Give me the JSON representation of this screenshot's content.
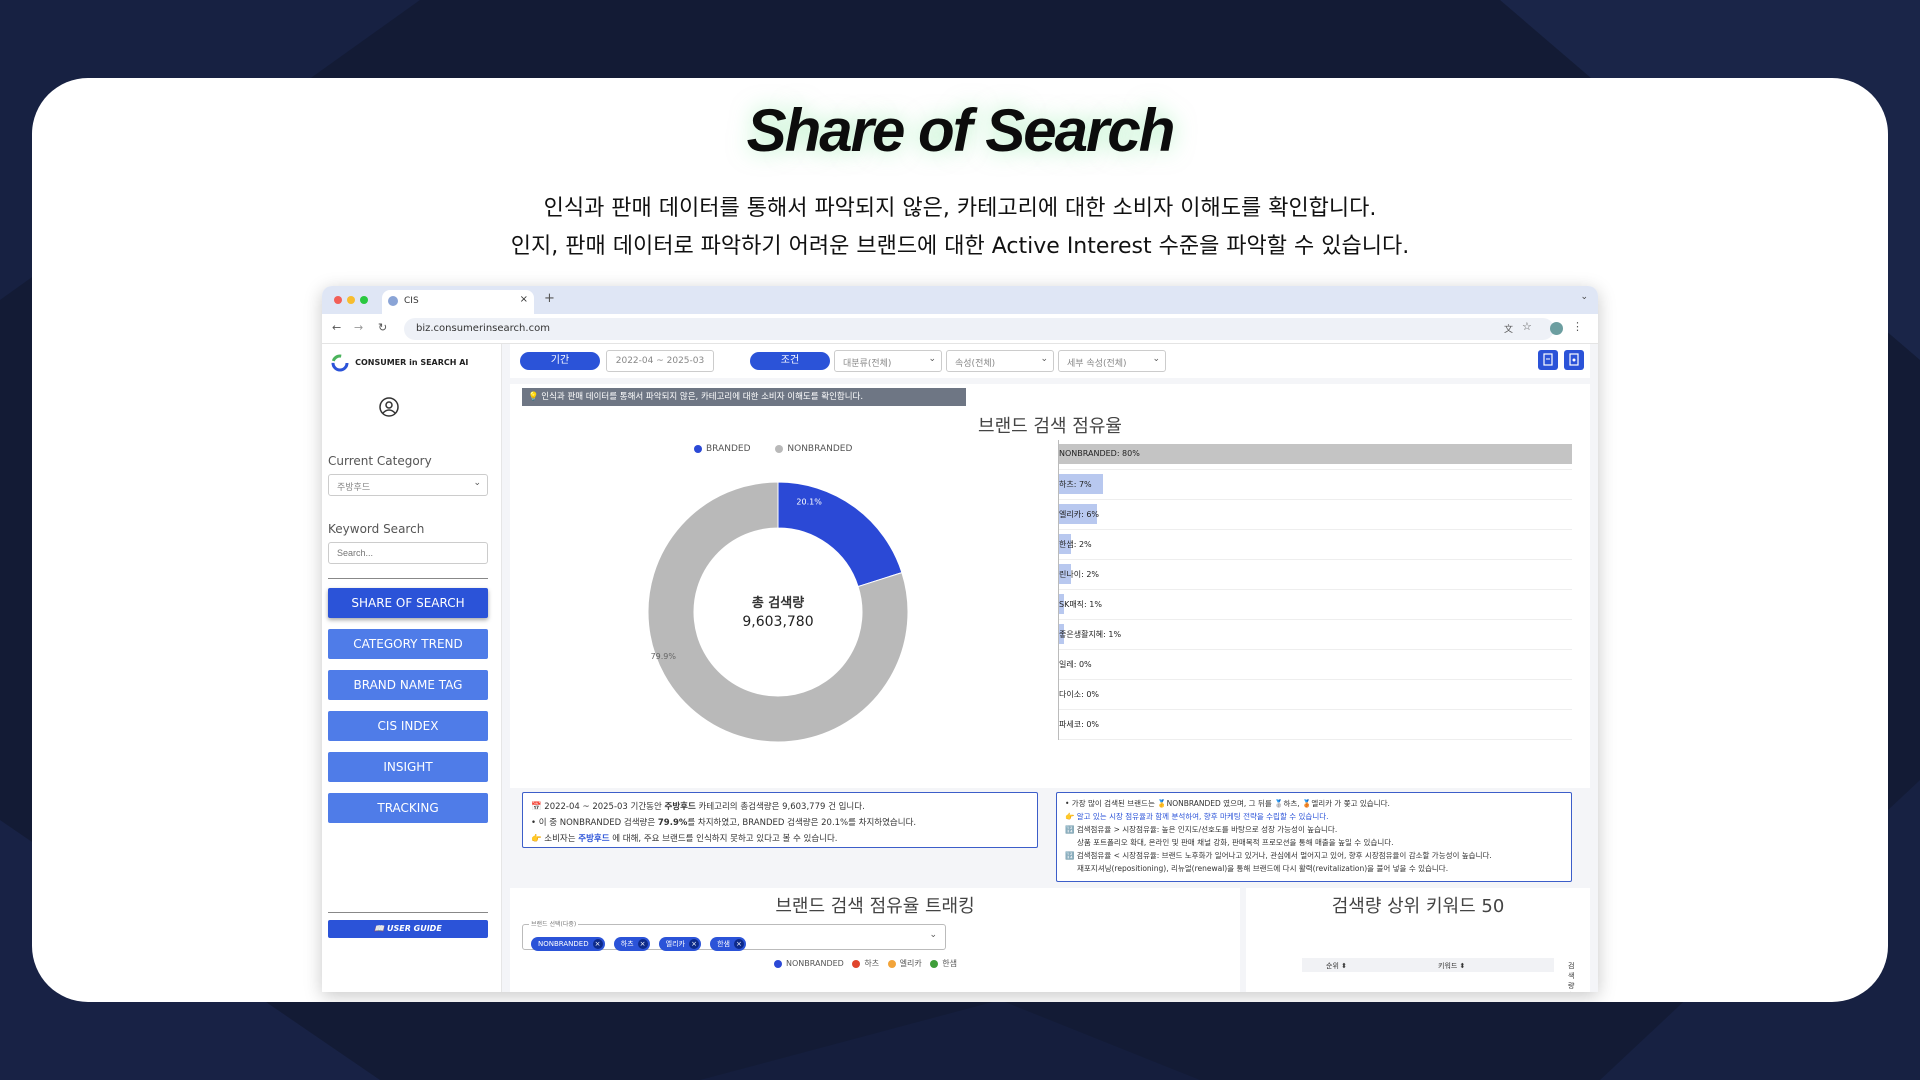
{
  "hero": {
    "title": "Share of Search",
    "subtitle_line1": "인식과 판매 데이터를 통해서 파악되지 않은, 카테고리에 대한 소비자 이해도를 확인합니다.",
    "subtitle_line2": "인지, 판매 데이터로 파악하기 어려운 브랜드에 대한 Active Interest 수준을 파악할 수 있습니다."
  },
  "browser": {
    "tab_title": "CIS",
    "url": "biz.consumerinsearch.com"
  },
  "sidebar": {
    "logo_text": "CONSUMER in SEARCH AI",
    "current_category_label": "Current Category",
    "current_category_value": "주방후드",
    "keyword_search_label": "Keyword Search",
    "keyword_search_placeholder": "Search...",
    "nav": [
      {
        "label": "SHARE OF SEARCH",
        "active": true
      },
      {
        "label": "CATEGORY TREND",
        "active": false
      },
      {
        "label": "BRAND NAME TAG",
        "active": false
      },
      {
        "label": "CIS INDEX",
        "active": false
      },
      {
        "label": "INSIGHT",
        "active": false
      },
      {
        "label": "TRACKING",
        "active": false
      }
    ],
    "user_guide": "📖 USER GUIDE"
  },
  "filters": {
    "period_label": "기간",
    "period_value": "2022-04 ~ 2025-03",
    "condition_label": "조건",
    "major_category": "대분류(전체)",
    "attribute": "속성(전체)",
    "sub_attribute": "세부 속성(전체)"
  },
  "notice": "💡 인식과 판매 데이터를 통해서 파악되지 않은, 카테고리에 대한 소비자 이해도를 확인합니다.",
  "share_panel": {
    "title": "브랜드 검색 점유율",
    "legend": [
      {
        "name": "BRANDED",
        "color": "#2b49d6"
      },
      {
        "name": "NONBRANDED",
        "color": "#b9b9b9"
      }
    ],
    "center_label": "총 검색량",
    "center_value": "9,603,780",
    "branded_label": "20.1%",
    "nonbranded_label": "79.9%"
  },
  "chart_data": [
    {
      "type": "pie",
      "title": "브랜드 검색 점유율",
      "categories": [
        "BRANDED",
        "NONBRANDED"
      ],
      "values": [
        20.1,
        79.9
      ],
      "colors": [
        "#2b49d6",
        "#b9b9b9"
      ],
      "legend": "top"
    },
    {
      "type": "bar",
      "orientation": "horizontal",
      "categories": [
        "NONBRANDED",
        "하츠",
        "엘리카",
        "한샘",
        "린나이",
        "SK매직",
        "좋은생활지혜",
        "일레",
        "다이소",
        "파세코"
      ],
      "values": [
        80,
        7,
        6,
        2,
        2,
        1,
        1,
        0,
        0,
        0
      ],
      "labels": [
        "NONBRANDED: 80%",
        "하츠: 7%",
        "엘리카: 6%",
        "한샘: 2%",
        "린나이: 2%",
        "SK매직: 1%",
        "좋은생활지혜: 1%",
        "일레: 0%",
        "다이소: 0%",
        "파세코: 0%"
      ],
      "xlim": [
        0,
        80
      ]
    }
  ],
  "summary_left": [
    {
      "pre": "📅 2022-04 ~ 2025-03 기간동안 ",
      "bold": "주방후드",
      "post": " 카테고리의 총검색량은 9,603,779 건 입니다."
    },
    {
      "pre": "• 이 중 NONBRANDED 검색량은 ",
      "bold": "79.9%",
      "post": "를 차지하였고, BRANDED 검색량은 20.1%를 차지하였습니다."
    },
    {
      "pre": "👉 소비자는 ",
      "bold": "주방후드",
      "post": " 에 대해, 주요 브랜드를 인식하지 못하고 있다고 볼 수 있습니다."
    }
  ],
  "summary_right": [
    "• 가장 많이 검색된 브랜드는 🥇NONBRANDED 였으며, 그 뒤를 🥈하츠, 🥉엘리카 가 쫓고 있습니다.",
    "👉 알고 있는 시장 점유율과 함께 분석하여, 향후 마케팅 전략을 수립할 수 있습니다.",
    "🔢 검색점유율 > 시장점유율: 높은 인지도/선호도를 바탕으로 성장 가능성이 높습니다.",
    "상품 포트폴리오 확대, 온라인 및 판매 채널 강화, 판매목적 프로모션을 통해 매출을 높일 수 있습니다.",
    "🔢 검색점유율 < 시장점유율: 브랜드 노후화가 일어나고 있거나, 관심에서 멀어지고 있어, 향후 시장점유율이 감소할 가능성이 높습니다.",
    "재포지셔닝(repositioning), 리뉴얼(renewal)을 통해 브랜드에 다시 활력(revitalization)을 불어 넣을 수 있습니다."
  ],
  "tracking_panel": {
    "title": "브랜드 검색 점유율 트래킹",
    "select_label": "브랜드 선택(다중)",
    "chips": [
      "NONBRANDED",
      "하츠",
      "엘리카",
      "한샘"
    ],
    "legend": [
      {
        "name": "NONBRANDED",
        "color": "#2b49d6"
      },
      {
        "name": "하츠",
        "color": "#e0452d"
      },
      {
        "name": "엘리카",
        "color": "#f2a43a"
      },
      {
        "name": "한샘",
        "color": "#3f9e3a"
      }
    ]
  },
  "keywords_panel": {
    "title": "검색량 상위 키워드 50",
    "columns": [
      "순위",
      "키워드",
      "검색량"
    ]
  }
}
